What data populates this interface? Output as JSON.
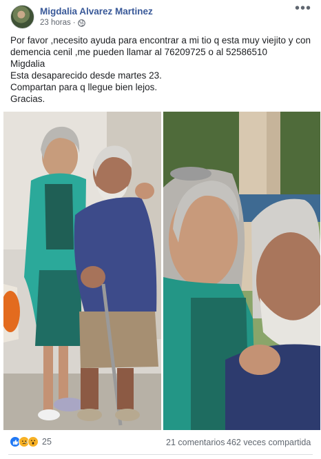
{
  "post": {
    "author": "Migdalia Alvarez Martinez",
    "time": "23 horas",
    "dot": "·",
    "more": "•••",
    "text_lines": [
      "Por favor ,necesito ayuda para encontrar a mi tio q esta muy viejito y con",
      "demencia cenil ,me pueden llamar al 76209725 o al 52586510",
      "Migdalia",
      "Esta desaparecido desde martes 23.",
      "Compartan para q llegue bien lejos.",
      "Gracias."
    ]
  },
  "stats": {
    "reaction_count": "25",
    "reaction_icons": [
      "like-icon",
      "sad-icon",
      "wow-icon"
    ],
    "comments": "21 comentarios",
    "shares": "462 veces compartida"
  },
  "colors": {
    "author": "#385898",
    "meta": "#616770",
    "like": "#2078f4",
    "emoji": "#f7b125"
  }
}
